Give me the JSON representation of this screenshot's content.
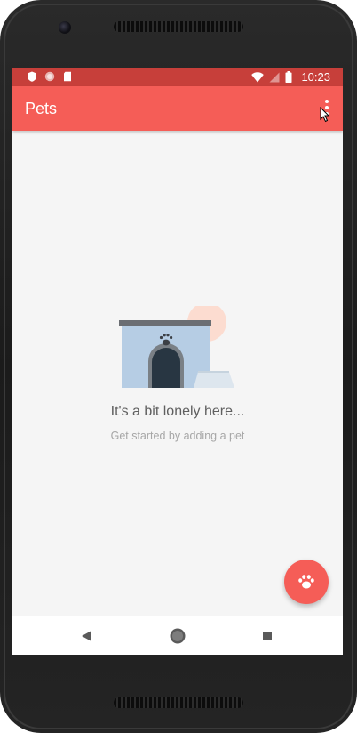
{
  "status_bar": {
    "time": "10:23",
    "left_icons": [
      "shield-icon",
      "circle-icon",
      "sd-card-icon"
    ],
    "right_icons": [
      "wifi-icon",
      "signal-icon",
      "battery-icon"
    ]
  },
  "app_bar": {
    "title": "Pets",
    "menu_icon": "more-vert-icon"
  },
  "empty_state": {
    "title": "It's a bit lonely here...",
    "subtitle": "Get started by adding a pet",
    "illustration": "dog-house-illustration"
  },
  "fab": {
    "icon": "paw-icon"
  },
  "navigation_bar": {
    "back_icon": "back-triangle-icon",
    "home_icon": "home-circle-icon",
    "recents_icon": "recents-square-icon"
  },
  "colors": {
    "primary": "#f55d57",
    "primary_dark": "#c73f3a",
    "background": "#f5f5f5"
  }
}
